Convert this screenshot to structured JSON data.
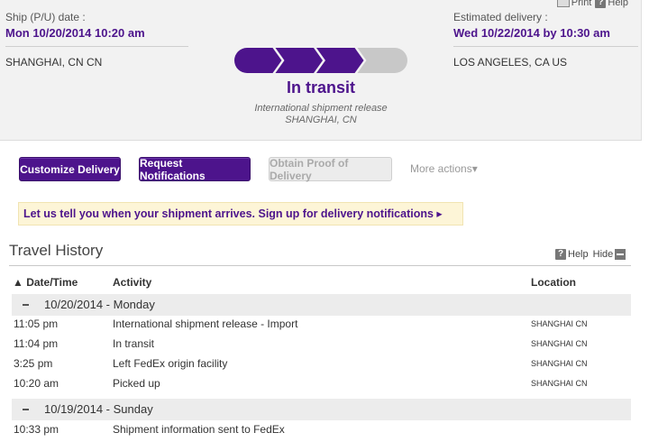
{
  "utility": {
    "print": "Print",
    "help": "Help",
    "help_glyph": "?"
  },
  "shipment": {
    "ship_label": "Ship (P/U) date :",
    "ship_date": "Mon 10/20/2014 10:20 am",
    "origin": "SHANGHAI, CN CN",
    "est_label": "Estimated delivery :",
    "est_date": "Wed 10/22/2014 by 10:30 am",
    "destination": "LOS ANGELES, CA US"
  },
  "progress": {
    "steps_total": 4,
    "steps_completed": 3,
    "active_color": "#4d148c",
    "inactive_color": "#c8c8c8"
  },
  "status": {
    "title": "In transit",
    "detail": "International shipment release",
    "location": "SHANGHAI, CN"
  },
  "actions": {
    "customize": "Customize Delivery",
    "notifications": "Request Notifications",
    "proof": "Obtain Proof of Delivery",
    "more": "More actions▾"
  },
  "banner": {
    "text": "Let us tell you when your shipment arrives. Sign up for delivery notifications ▸"
  },
  "travel_history": {
    "title": "Travel History",
    "help": "Help",
    "help_glyph": "?",
    "hide": "Hide",
    "columns": {
      "datetime": "▲ Date/Time",
      "activity": "Activity",
      "location": "Location"
    },
    "groups": [
      {
        "date": "10/20/2014 - Monday",
        "events": [
          {
            "time": "11:05 pm",
            "activity": "International shipment release - Import",
            "location": "SHANGHAI CN"
          },
          {
            "time": "11:04 pm",
            "activity": "In transit",
            "location": "SHANGHAI CN"
          },
          {
            "time": "3:25 pm",
            "activity": "Left FedEx origin facility",
            "location": "SHANGHAI CN"
          },
          {
            "time": "10:20 am",
            "activity": "Picked up",
            "location": "SHANGHAI CN"
          }
        ]
      },
      {
        "date": "10/19/2014 - Sunday",
        "events": [
          {
            "time": "10:33 pm",
            "activity": "Shipment information sent to FedEx",
            "location": ""
          }
        ]
      }
    ]
  },
  "colors": {
    "brand_purple": "#4d148c",
    "banner_bg": "#fdf5d7",
    "panel_bg": "#f2f2f2"
  }
}
